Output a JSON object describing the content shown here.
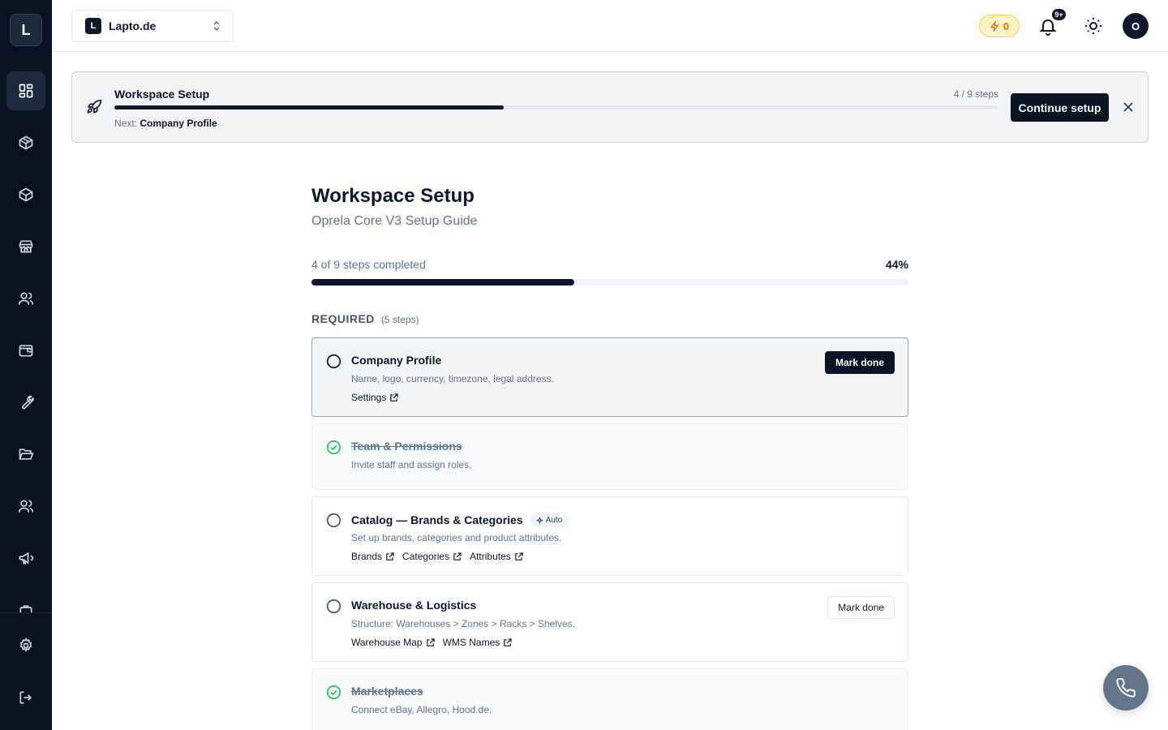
{
  "app": {
    "logo_letter": "L"
  },
  "workspace": {
    "badge": "L",
    "name": "Lapto.de"
  },
  "header": {
    "credits": "0",
    "notifications": "9+",
    "avatar": "O"
  },
  "sidebar": {
    "items": [
      {
        "icon": "dashboard-icon",
        "active": true
      },
      {
        "icon": "package-icon"
      },
      {
        "icon": "box-icon"
      },
      {
        "icon": "store-icon"
      },
      {
        "icon": "users-icon"
      },
      {
        "icon": "wallet-icon"
      },
      {
        "icon": "wrench-icon"
      },
      {
        "icon": "folder-open-icon"
      },
      {
        "icon": "team-icon"
      },
      {
        "icon": "megaphone-icon"
      }
    ],
    "bottom": [
      {
        "icon": "settings-icon"
      },
      {
        "icon": "logout-icon"
      }
    ]
  },
  "banner": {
    "title": "Workspace Setup",
    "steps": "4 / 9 steps",
    "progress": 0.44,
    "next_label": "Next:",
    "next_value": "Company Profile",
    "continue_label": "Continue setup"
  },
  "page": {
    "title": "Workspace Setup",
    "subtitle": "Oprela Core V3 Setup Guide",
    "progress_text": "4 of 9 steps completed",
    "progress_pct": "44%",
    "progress": 0.44
  },
  "section": {
    "title": "REQUIRED",
    "count": "(5 steps)"
  },
  "steps": [
    {
      "title": "Company Profile",
      "desc": "Name, logo, currency, timezone, legal address.",
      "links": [
        "Settings"
      ],
      "state": "current",
      "action": "Mark done"
    },
    {
      "title": "Team & Permissions",
      "desc": "Invite staff and assign roles.",
      "links": [],
      "state": "done"
    },
    {
      "title": "Catalog — Brands & Categories",
      "badge": "Auto",
      "desc": "Set up brands, categories and product attributes.",
      "links": [
        "Brands",
        "Categories",
        "Attributes"
      ],
      "state": "todo"
    },
    {
      "title": "Warehouse & Logistics",
      "desc": "Structure: Warehouses > Zones > Racks > Shelves.",
      "links": [
        "Warehouse Map",
        "WMS Names"
      ],
      "state": "todo",
      "action": "Mark done"
    },
    {
      "title": "Marketplaces",
      "desc": "Connect eBay, Allegro, Hood.de.",
      "links": [],
      "state": "done"
    }
  ],
  "colors": {
    "sidebar": "#0b1220",
    "accent": "#0f172a",
    "success": "#22c55e",
    "credits": "#d97706"
  }
}
